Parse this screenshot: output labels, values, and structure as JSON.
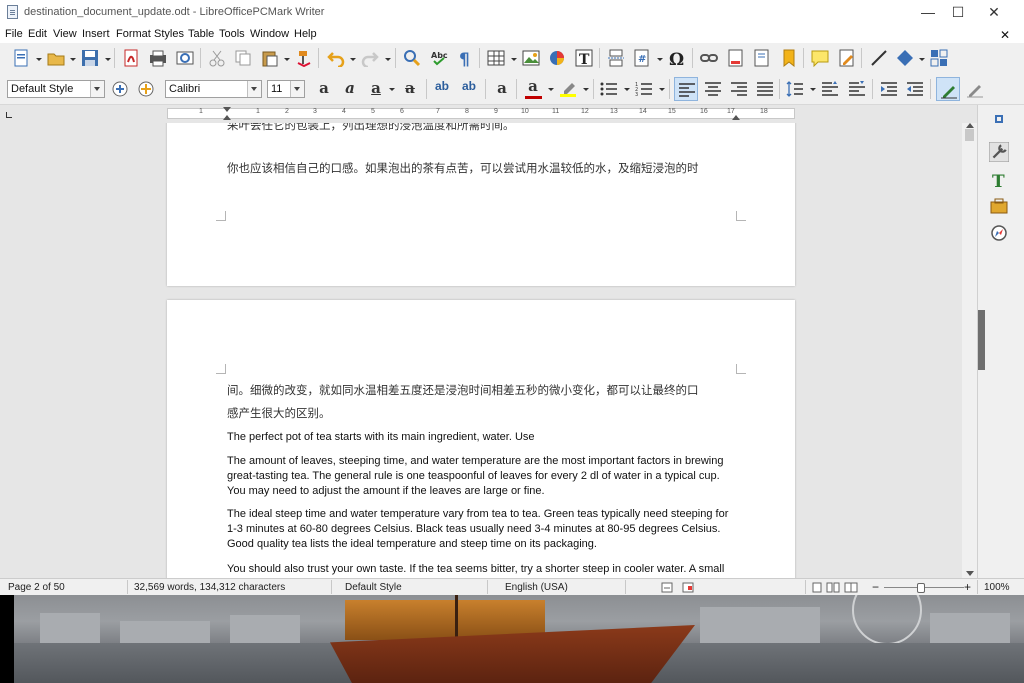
{
  "window": {
    "title": "destination_document_update.odt - LibreOfficePCMark Writer",
    "minimize": "—",
    "maximize": "☐",
    "close": "✕"
  },
  "menu": [
    "File",
    "Edit",
    "View",
    "Insert",
    "Format",
    "Styles",
    "Table",
    "Tools",
    "Window",
    "Help"
  ],
  "menu_close": "✕",
  "formatting": {
    "paragraph_style": "Default Style",
    "font_name": "Calibri",
    "font_size": "11"
  },
  "ruler_numbers": [
    "1",
    "1",
    "2",
    "3",
    "4",
    "5",
    "6",
    "7",
    "8",
    "9",
    "10",
    "11",
    "12",
    "13",
    "14",
    "15",
    "16",
    "17",
    "18"
  ],
  "document": {
    "page1_line1": "采叶会任它的包装上，列出理想的浸泡温度和所需时间。",
    "page1_line2": "你也应该相信自己的口感。如果泡出的茶有点苦，可以尝试用水温较低的水，及缩短浸泡的时",
    "page2_line1": "间。细微的改变，就如同水温相差五度还是浸泡时间相差五秒的微小变化，都可以让最终的口",
    "page2_line2": "感产生很大的区别。",
    "para1": "The perfect pot of tea starts with its main ingredient, water. Use",
    "para2": "The amount of leaves, steeping time, and water temperature are the most important factors in brewing great-tasting tea. The general rule is one teaspoonful of leaves for every 2 dl of water in a typical cup. You may need to adjust the amount if the leaves are large or fine.",
    "para3": "The ideal steep time and water temperature vary from tea to tea. Green teas typically need steeping for 1-3 minutes at 60-80 degrees Celsius. Black teas usually need 3-4 minutes at 80-95 degrees Celsius. Good quality tea lists the ideal temperature and steep time on its packaging.",
    "para4": "You should also trust your own taste. If the tea seems bitter, try a shorter steep in cooler water. A small"
  },
  "status": {
    "page": "Page 2 of 50",
    "words": "32,569 words, 134,312 characters",
    "style": "Default Style",
    "language": "English (USA)",
    "zoom": "100%",
    "zoom_out": "−",
    "zoom_in": "+"
  },
  "colors": {
    "accent": "#cfe3f7",
    "font_color": "#c00000",
    "highlight": "#ffff00"
  }
}
